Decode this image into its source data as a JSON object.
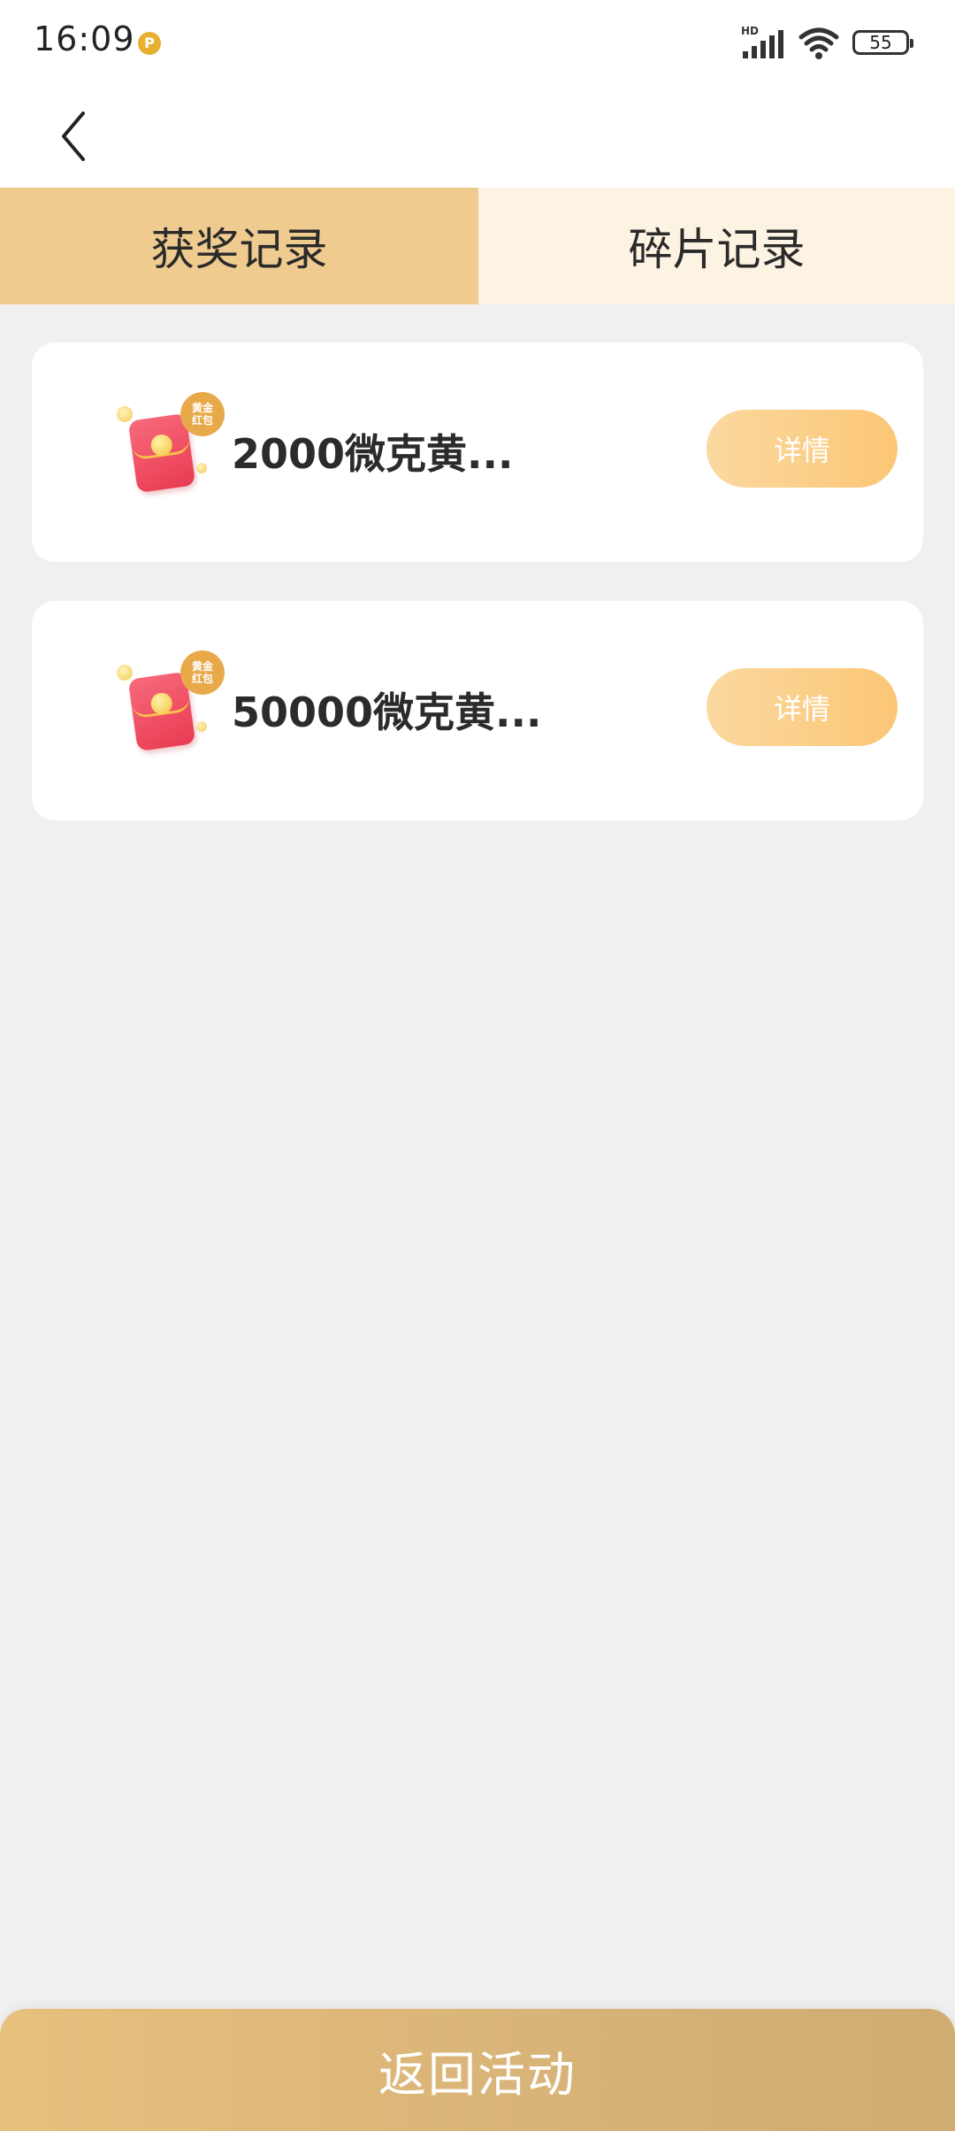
{
  "status_bar": {
    "time": "16:09",
    "app_icon_letter": "P",
    "network_label": "HD",
    "battery": "55"
  },
  "tabs": [
    {
      "label": "获奖记录",
      "active": true
    },
    {
      "label": "碎片记录",
      "active": false
    }
  ],
  "records": [
    {
      "title": "2000微克黄...",
      "badge_line1": "黄金",
      "badge_line2": "红包",
      "button": "详情"
    },
    {
      "title": "50000微克黄...",
      "badge_line1": "黄金",
      "badge_line2": "红包",
      "button": "详情"
    }
  ],
  "footer": {
    "return_label": "返回活动"
  },
  "colors": {
    "tab_active": "#efcb90",
    "tab_inactive": "#fdf3e2",
    "button_gradient_start": "#fbd9a0",
    "button_gradient_end": "#fbc675",
    "footer_gradient_start": "#e6c07c",
    "footer_gradient_end": "#cfac72",
    "page_background": "#f0f0f0"
  },
  "icons": {
    "back": "chevron-left-icon",
    "signal": "cellular-signal-icon",
    "wifi": "wifi-icon",
    "battery": "battery-icon",
    "prize": "red-envelope-icon"
  }
}
